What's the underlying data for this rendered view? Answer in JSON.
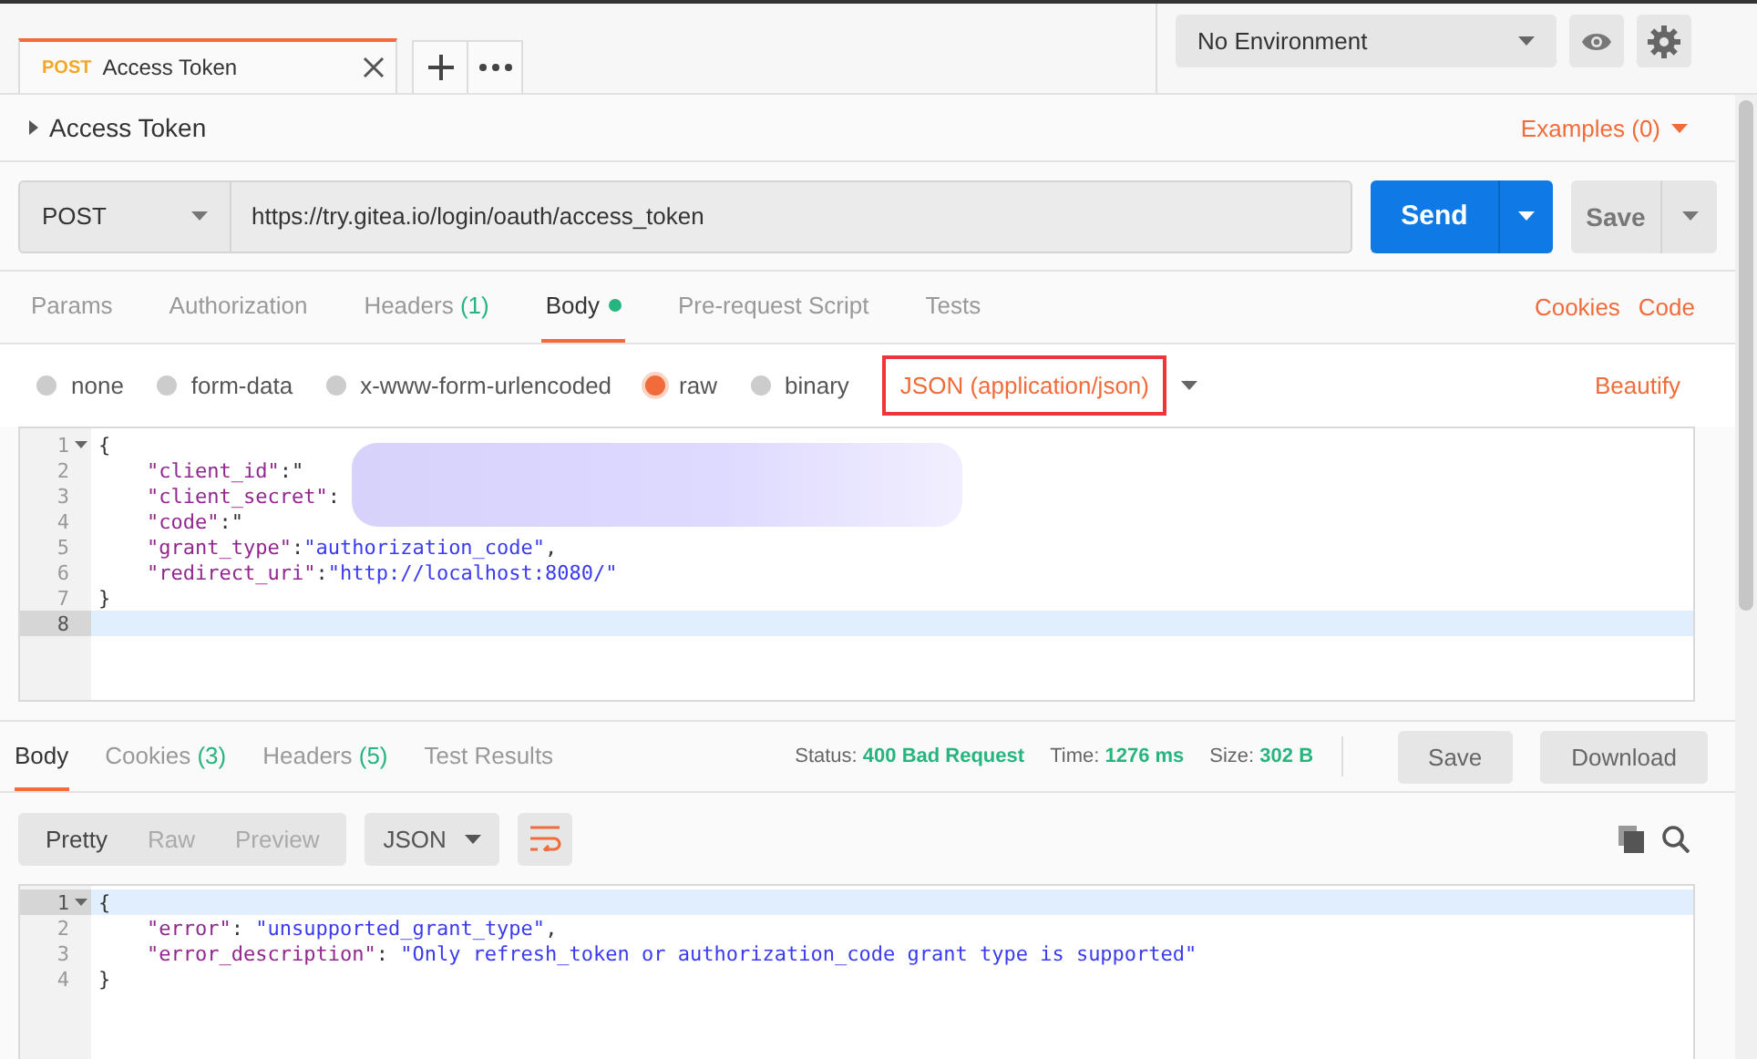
{
  "tabs": [
    {
      "method": "POST",
      "title": "Access Token",
      "selected": true
    }
  ],
  "environment": {
    "value": "No Environment"
  },
  "request": {
    "name": "Access Token",
    "examples": "Examples (0)",
    "method": "POST",
    "url": "https://try.gitea.io/login/oauth/access_token",
    "send": "Send",
    "save": "Save"
  },
  "request_tabs": [
    {
      "label": "Params",
      "selected": false
    },
    {
      "label": "Authorization",
      "selected": false
    },
    {
      "label": "Headers",
      "count": "(1)",
      "selected": false
    },
    {
      "label": "Body",
      "has_content": true,
      "selected": true
    },
    {
      "label": "Pre-request Script",
      "selected": false
    },
    {
      "label": "Tests",
      "selected": false
    }
  ],
  "request_links": [
    "Cookies",
    "Code"
  ],
  "body_modes": [
    {
      "label": "none",
      "selected": false
    },
    {
      "label": "form-data",
      "selected": false
    },
    {
      "label": "x-www-form-urlencoded",
      "selected": false
    },
    {
      "label": "raw",
      "selected": true
    },
    {
      "label": "binary",
      "selected": false
    }
  ],
  "content_type": {
    "value": "JSON (application/json)",
    "highlighted": true
  },
  "beautify": "Beautify",
  "request_body": {
    "redacted": true,
    "lines": [
      {
        "number": "1",
        "fold": true,
        "active": false,
        "tokens": [
          {
            "kind": "punct",
            "text": "{"
          }
        ]
      },
      {
        "number": "2",
        "active": false,
        "tokens": [
          {
            "kind": "key",
            "text": "    \"client_id\""
          },
          {
            "kind": "punct",
            "text": ":\""
          }
        ]
      },
      {
        "number": "3",
        "active": false,
        "tokens": [
          {
            "kind": "key",
            "text": "    \"client_secret\""
          },
          {
            "kind": "punct",
            "text": ":"
          }
        ]
      },
      {
        "number": "4",
        "active": false,
        "tokens": [
          {
            "kind": "key",
            "text": "    \"code\""
          },
          {
            "kind": "punct",
            "text": ":\""
          }
        ]
      },
      {
        "number": "5",
        "active": false,
        "tokens": [
          {
            "kind": "key",
            "text": "    \"grant_type\""
          },
          {
            "kind": "punct",
            "text": ":"
          },
          {
            "kind": "value",
            "text": "\"authorization_code\""
          },
          {
            "kind": "punct",
            "text": ","
          }
        ]
      },
      {
        "number": "6",
        "active": false,
        "tokens": [
          {
            "kind": "key",
            "text": "    \"redirect_uri\""
          },
          {
            "kind": "punct",
            "text": ":"
          },
          {
            "kind": "value",
            "text": "\"http://localhost:8080/\""
          }
        ]
      },
      {
        "number": "7",
        "active": false,
        "tokens": [
          {
            "kind": "punct",
            "text": "}"
          }
        ]
      },
      {
        "number": "8",
        "active": true
      }
    ]
  },
  "response_tabs": [
    {
      "label": "Body",
      "selected": true
    },
    {
      "label": "Cookies",
      "count": "(3)",
      "selected": false
    },
    {
      "label": "Headers",
      "count": "(5)",
      "selected": false
    },
    {
      "label": "Test Results",
      "selected": false
    }
  ],
  "response_meta": [
    {
      "label": "Status:",
      "value": "400 Bad Request"
    },
    {
      "label": "Time:",
      "value": "1276 ms"
    },
    {
      "label": "Size:",
      "value": "302 B"
    }
  ],
  "response_buttons": [
    "Save",
    "Download"
  ],
  "view_modes": [
    {
      "label": "Pretty",
      "selected": true
    },
    {
      "label": "Raw",
      "selected": false
    },
    {
      "label": "Preview",
      "selected": false
    }
  ],
  "response_format": "JSON",
  "wrap_enabled": true,
  "response_body": {
    "lines": [
      {
        "number": "1",
        "fold": true,
        "active": true,
        "tokens": [
          {
            "kind": "punct",
            "text": "{"
          }
        ]
      },
      {
        "number": "2",
        "active": false,
        "tokens": [
          {
            "kind": "key",
            "text": "    \"error\""
          },
          {
            "kind": "punct",
            "text": ": "
          },
          {
            "kind": "value",
            "text": "\"unsupported_grant_type\""
          },
          {
            "kind": "punct",
            "text": ","
          }
        ]
      },
      {
        "number": "3",
        "active": false,
        "tokens": [
          {
            "kind": "key",
            "text": "    \"error_description\""
          },
          {
            "kind": "punct",
            "text": ": "
          },
          {
            "kind": "value",
            "text": "\"Only refresh_token or authorization_code grant type is supported\""
          }
        ]
      },
      {
        "number": "4",
        "active": false,
        "tokens": [
          {
            "kind": "punct",
            "text": "}"
          }
        ]
      }
    ]
  }
}
